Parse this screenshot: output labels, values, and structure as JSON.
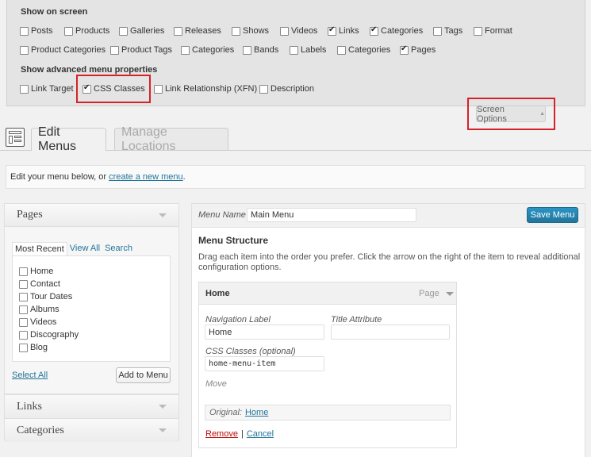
{
  "screen_options": {
    "heading_show": "Show on screen",
    "row1": [
      {
        "label": "Posts",
        "checked": false
      },
      {
        "label": "Products",
        "checked": false
      },
      {
        "label": "Galleries",
        "checked": false
      },
      {
        "label": "Releases",
        "checked": false
      },
      {
        "label": "Shows",
        "checked": false
      },
      {
        "label": "Videos",
        "checked": false
      },
      {
        "label": "Links",
        "checked": true
      },
      {
        "label": "Categories",
        "checked": true
      },
      {
        "label": "Tags",
        "checked": false
      },
      {
        "label": "Format",
        "checked": false
      }
    ],
    "row2": [
      {
        "label": "Product Categories",
        "checked": false
      },
      {
        "label": "Product Tags",
        "checked": false
      },
      {
        "label": "Categories",
        "checked": false
      },
      {
        "label": "Bands",
        "checked": false
      },
      {
        "label": "Labels",
        "checked": false
      },
      {
        "label": "Categories",
        "checked": false
      },
      {
        "label": "Pages",
        "checked": true
      }
    ],
    "heading_advanced": "Show advanced menu properties",
    "row3": [
      {
        "label": "Link Target",
        "checked": false
      },
      {
        "label": "CSS Classes",
        "checked": true
      },
      {
        "label": "Link Relationship (XFN)",
        "checked": false
      },
      {
        "label": "Description",
        "checked": false
      }
    ],
    "toggle_label": "Screen Options"
  },
  "tabs": {
    "edit": "Edit Menus",
    "manage": "Manage Locations"
  },
  "notice": {
    "text": "Edit your menu below, or ",
    "link": "create a new menu",
    "suffix": "."
  },
  "pages_panel": {
    "title": "Pages",
    "tabs": [
      "Most Recent",
      "View All",
      "Search"
    ],
    "items": [
      "Home",
      "Contact",
      "Tour Dates",
      "Albums",
      "Videos",
      "Discography",
      "Blog"
    ],
    "select_all": "Select All",
    "add_button": "Add to Menu"
  },
  "links_panel": {
    "title": "Links"
  },
  "categories_panel": {
    "title": "Categories"
  },
  "menu": {
    "name_label": "Menu Name",
    "name_value": "Main Menu",
    "save_label": "Save Menu",
    "structure_title": "Menu Structure",
    "instructions_line1": "Drag each item into the order you prefer. Click the arrow on the right of the item to reveal additional",
    "instructions_line2": "configuration options.",
    "item": {
      "title": "Home",
      "type": "Page",
      "nav_label": "Navigation Label",
      "nav_value": "Home",
      "title_attr_label": "Title Attribute",
      "title_attr_value": "",
      "css_label": "CSS Classes (optional)",
      "css_value": "home-menu-item",
      "move_label": "Move",
      "original_label": "Original:",
      "original_link": "Home",
      "remove": "Remove",
      "separator": "|",
      "cancel": "Cancel"
    }
  }
}
